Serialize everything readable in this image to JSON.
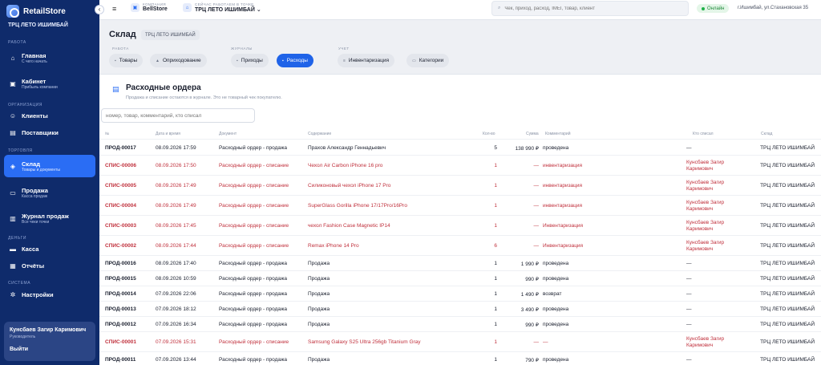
{
  "sidebar": {
    "brand": "RetailStore",
    "store": "ТРЦ ЛЕТО ИШИМБАЙ",
    "sections": {
      "work": "РАБОТА",
      "org": "ОРГАНИЗАЦИЯ",
      "trade": "ТОРГОВЛЯ",
      "money": "ДЕНЬГИ",
      "system": "СИСТЕМА"
    },
    "items": [
      {
        "title": "Главная",
        "sub": "С чего начать"
      },
      {
        "title": "Кабинет",
        "sub": "Прибыль компании"
      },
      {
        "title": "Клиенты",
        "sub": ""
      },
      {
        "title": "Поставщики",
        "sub": ""
      },
      {
        "title": "Склад",
        "sub": "Товары и документы"
      },
      {
        "title": "Продажа",
        "sub": "Касса продаж"
      },
      {
        "title": "Журнал продаж",
        "sub": "Все чеки точки"
      },
      {
        "title": "Касса",
        "sub": ""
      },
      {
        "title": "Отчёты",
        "sub": ""
      },
      {
        "title": "Настройки",
        "sub": ""
      }
    ],
    "user": {
      "name": "Кунсбаев Загир Каримович",
      "role": "Руководитель",
      "logout": "Выйти"
    }
  },
  "topbar": {
    "company_label": "КОМПАНИЯ",
    "company": "BellStore",
    "point_label": "СЕЙЧАС РАБОТАЕМ В ТОЧКЕ",
    "point": "ТРЦ ЛЕТО ИШИМБАЙ",
    "search_placeholder": "Чек, приход, расход, IMEI, товар, клиент",
    "status": "Онлайн",
    "address": "г.Ишимбай, ул.Стахановская 35"
  },
  "page": {
    "title": "Склад",
    "store_chip": "ТРЦ ЛЕТО ИШИМБАЙ",
    "groups": {
      "work": "РАБОТА",
      "journals": "ЖУРНАЛЫ",
      "account": "УЧЕТ"
    },
    "tabs": [
      "Товары",
      "Оприходование",
      "Приходы",
      "Расходы",
      "Инвентаризация",
      "Категории"
    ]
  },
  "card": {
    "title": "Расходные ордера",
    "subtitle": "Продажа и списание остаются в журнале. Это не товарный чек покупателю.",
    "filter_placeholder": "номер, товар, комментарий, кто списал"
  },
  "table": {
    "headers": [
      "№",
      "Дата и время",
      "Документ",
      "Содержание",
      "Кол-во",
      "Сумма",
      "Комментарий",
      "Кто списал",
      "Склад"
    ],
    "rows": [
      {
        "num": "ПРОД-00017",
        "date": "08.09.2026 17:59",
        "doc": "Расходный ордер - продажа",
        "content": "Прахов Александр Геннадьевич",
        "qty": "5",
        "sum": "138 990 ₽",
        "comment": "проведена",
        "who": "—",
        "store": "ТРЦ ЛЕТО ИШИМБАЙ",
        "kind": "sale"
      },
      {
        "num": "СПИС-00006",
        "date": "08.09.2026 17:50",
        "doc": "Расходный ордер - списание",
        "content": "Чехол Air Carbon iPhone 16 pro",
        "qty": "1",
        "sum": "—",
        "comment": "инвентаризация",
        "who": "Кунсбаев Загир Каримович",
        "store": "ТРЦ ЛЕТО ИШИМБАЙ",
        "kind": "writeoff"
      },
      {
        "num": "СПИС-00005",
        "date": "08.09.2026 17:49",
        "doc": "Расходный ордер - списание",
        "content": "Силиконовый чехол iPhone 17 Pro",
        "qty": "1",
        "sum": "—",
        "comment": "инвентаризация",
        "who": "Кунсбаев Загир Каримович",
        "store": "ТРЦ ЛЕТО ИШИМБАЙ",
        "kind": "writeoff"
      },
      {
        "num": "СПИС-00004",
        "date": "08.09.2026 17:49",
        "doc": "Расходный ордер - списание",
        "content": "SuperGlass Gorilla iPhone 17/17Pro/16Pro",
        "qty": "1",
        "sum": "—",
        "comment": "инвентаризация",
        "who": "Кунсбаев Загир Каримович",
        "store": "ТРЦ ЛЕТО ИШИМБАЙ",
        "kind": "writeoff"
      },
      {
        "num": "СПИС-00003",
        "date": "08.09.2026 17:45",
        "doc": "Расходный ордер - списание",
        "content": "чехол Fashion Case Magnetic IP14",
        "qty": "1",
        "sum": "—",
        "comment": "Инвентаризация",
        "who": "Кунсбаев Загир Каримович",
        "store": "ТРЦ ЛЕТО ИШИМБАЙ",
        "kind": "writeoff"
      },
      {
        "num": "СПИС-00002",
        "date": "08.09.2026 17:44",
        "doc": "Расходный ордер - списание",
        "content": "Remax iPhone 14 Pro",
        "qty": "6",
        "sum": "—",
        "comment": "Инвентаризация",
        "who": "Кунсбаев Загир Каримович",
        "store": "ТРЦ ЛЕТО ИШИМБАЙ",
        "kind": "writeoff"
      },
      {
        "num": "ПРОД-00016",
        "date": "08.09.2026 17:40",
        "doc": "Расходный ордер - продажа",
        "content": "Продажа",
        "qty": "1",
        "sum": "1 990 ₽",
        "comment": "проведена",
        "who": "—",
        "store": "ТРЦ ЛЕТО ИШИМБАЙ",
        "kind": "sale"
      },
      {
        "num": "ПРОД-00015",
        "date": "08.09.2026 10:59",
        "doc": "Расходный ордер - продажа",
        "content": "Продажа",
        "qty": "1",
        "sum": "990 ₽",
        "comment": "проведена",
        "who": "—",
        "store": "ТРЦ ЛЕТО ИШИМБАЙ",
        "kind": "sale"
      },
      {
        "num": "ПРОД-00014",
        "date": "07.09.2026 22:06",
        "doc": "Расходный ордер - продажа",
        "content": "Продажа",
        "qty": "1",
        "sum": "1 490 ₽",
        "comment": "возврат",
        "who": "—",
        "store": "ТРЦ ЛЕТО ИШИМБАЙ",
        "kind": "sale"
      },
      {
        "num": "ПРОД-00013",
        "date": "07.09.2026 18:12",
        "doc": "Расходный ордер - продажа",
        "content": "Продажа",
        "qty": "1",
        "sum": "3 490 ₽",
        "comment": "проведена",
        "who": "—",
        "store": "ТРЦ ЛЕТО ИШИМБАЙ",
        "kind": "sale"
      },
      {
        "num": "ПРОД-00012",
        "date": "07.09.2026 16:34",
        "doc": "Расходный ордер - продажа",
        "content": "Продажа",
        "qty": "1",
        "sum": "990 ₽",
        "comment": "проведена",
        "who": "—",
        "store": "ТРЦ ЛЕТО ИШИМБАЙ",
        "kind": "sale"
      },
      {
        "num": "СПИС-00001",
        "date": "07.09.2026 15:31",
        "doc": "Расходный ордер - списание",
        "content": "Samsung Galaxy S25 Ultra 256gb Titanium Gray",
        "qty": "1",
        "sum": "—",
        "comment": "—",
        "who": "Кунсбаев Загир Каримович",
        "store": "ТРЦ ЛЕТО ИШИМБАЙ",
        "kind": "writeoff"
      },
      {
        "num": "ПРОД-00011",
        "date": "07.09.2026 13:44",
        "doc": "Расходный ордер - продажа",
        "content": "Продажа",
        "qty": "1",
        "sum": "790 ₽",
        "comment": "проведена",
        "who": "—",
        "store": "ТРЦ ЛЕТО ИШИМБАЙ",
        "kind": "sale"
      }
    ]
  },
  "colors": {
    "sidebar": "#0f2b6b",
    "accent": "#2a6df4",
    "writeoff": "#c0303c",
    "online": "#1f8a3a"
  }
}
